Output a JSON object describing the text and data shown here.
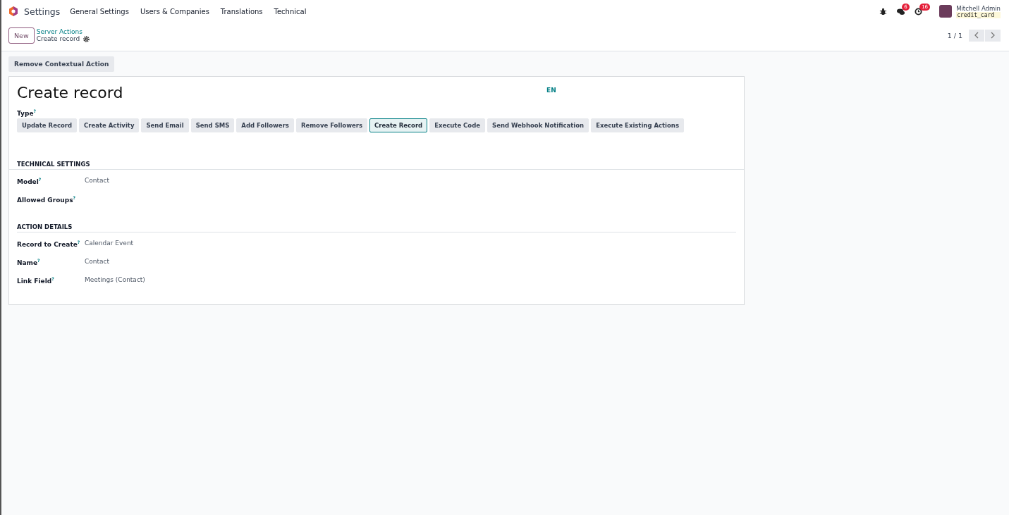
{
  "navbar": {
    "app_name": "Settings",
    "menu": [
      "General Settings",
      "Users & Companies",
      "Translations",
      "Technical"
    ],
    "messages_badge": "6",
    "activities_badge": "16",
    "user_name": "Mitchell Admin",
    "database": "credit_card"
  },
  "control_panel": {
    "new_button": "New",
    "breadcrumb": "Server Actions",
    "record_title": "Create record",
    "pager": "1 / 1"
  },
  "action_buttons": [
    "Remove Contextual Action"
  ],
  "form": {
    "name": "Create record",
    "language": "EN",
    "type_label": "Type$^{?}$",
    "types": [
      {
        "label": "Update Record",
        "selected": false
      },
      {
        "label": "Create Activity",
        "selected": false
      },
      {
        "label": "Send Email",
        "selected": false
      },
      {
        "label": "Send SMS",
        "selected": false
      },
      {
        "label": "Add Followers",
        "selected": false
      },
      {
        "label": "Remove Followers",
        "selected": false
      },
      {
        "label": "Create Record",
        "selected": true
      },
      {
        "label": "Execute Code",
        "selected": false
      },
      {
        "label": "Send Webhook Notification",
        "selected": false
      },
      {
        "label": "Execute Existing Actions",
        "selected": false
      }
    ],
    "sections": [
      {
        "title": "TECHNICAL SETTINGS",
        "fields": [
          {
            "label": "Model$^{?}$",
            "value": "Contact"
          },
          {
            "label": "Allowed Groups$^{?}$"
          }
        ]
      },
      {
        "title": "ACTION DETAILS",
        "fields": [
          {
            "label": "Record to Create$^{?}$",
            "value": "Calendar Event"
          },
          {
            "label": "Name$^{?}$",
            "value": "Contact"
          },
          {
            "label": "Link Field$^{?}$",
            "value": "Meetings (Contact)"
          }
        ]
      }
    ]
  }
}
